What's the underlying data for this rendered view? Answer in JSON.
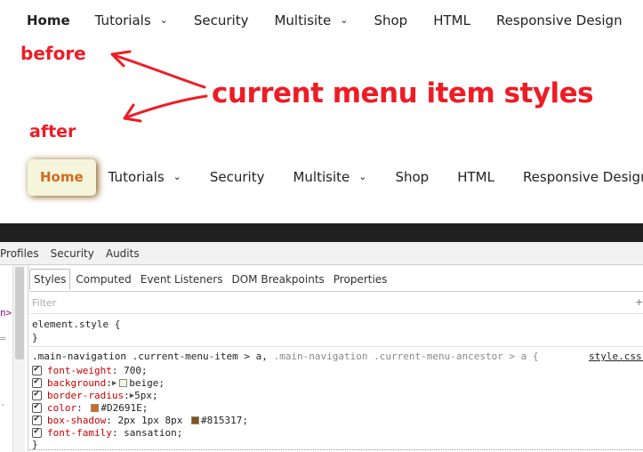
{
  "nav_before": {
    "items": [
      "Home",
      "Tutorials",
      "Security",
      "Multisite",
      "Shop",
      "HTML",
      "Responsive Design"
    ],
    "chevron": "⌄"
  },
  "nav_after": {
    "items": [
      "Home",
      "Tutorials",
      "Security",
      "Multisite",
      "Shop",
      "HTML",
      "Responsive Design"
    ],
    "chevron": "⌄"
  },
  "annotations": {
    "before": "before",
    "after": "after",
    "caption": "current menu item styles",
    "color": "#ee1c25"
  },
  "devtools": {
    "panels": [
      "Profiles",
      "Security",
      "Audits"
    ],
    "sub_tabs": [
      "Styles",
      "Computed",
      "Event Listeners",
      "DOM Breakpoints",
      "Properties"
    ],
    "active_sub_tab": "Styles",
    "filter_placeholder": "Filter",
    "filter_icon": "+",
    "element_style_open": "element.style {",
    "element_style_close": "}",
    "left_gutter": [
      "n>",
      "=",
      "-"
    ],
    "selector_main": ".main-navigation .current-menu-item > a, ",
    "selector_dim": ".main-navigation .current-menu-ancestor > a {",
    "source": "style.css:",
    "declarations": [
      {
        "prop": "font-weight",
        "value": "700;"
      },
      {
        "prop": "background",
        "value": "beige;",
        "swatch": "#f5f5dc",
        "triangle": true
      },
      {
        "prop": "border-radius",
        "value": "5px;",
        "triangle": true
      },
      {
        "prop": "color",
        "value": "#D2691E;",
        "swatch": "#D2691E"
      },
      {
        "prop": "box-shadow",
        "value": "2px 1px 8px ",
        "value2": "#815317;",
        "swatch": "#815317"
      },
      {
        "prop": "font-family",
        "value": "sansation;"
      }
    ],
    "rule_close": "}"
  }
}
